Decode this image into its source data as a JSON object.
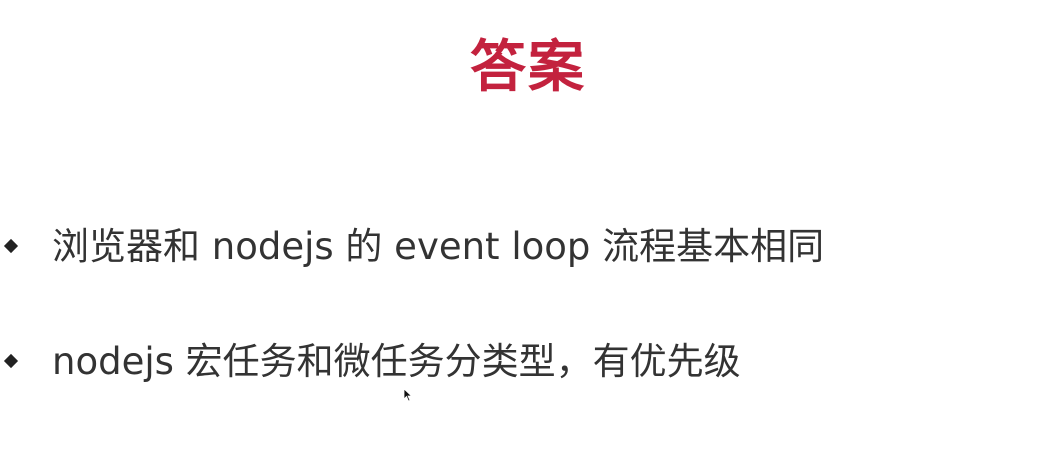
{
  "slide": {
    "title": "答案",
    "title_color": "#c3223e",
    "bullets": [
      {
        "text": "浏览器和 nodejs 的 event loop 流程基本相同"
      },
      {
        "text": "nodejs 宏任务和微任务分类型，有优先级"
      }
    ],
    "bullet_icon": "diamond-bullet-icon",
    "cursor_icon": "mouse-pointer-icon"
  }
}
